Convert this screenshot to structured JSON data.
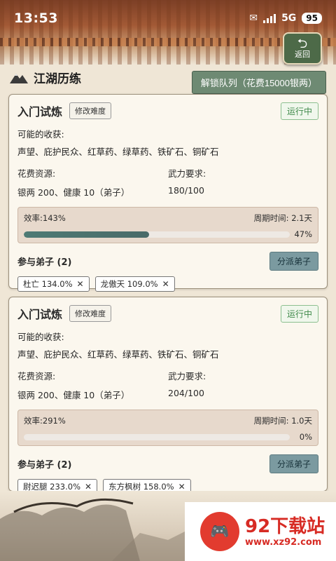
{
  "status_bar": {
    "time": "13:53",
    "network": "5G",
    "battery": "95"
  },
  "nav": {
    "back_label": "返回",
    "back_arrow": "⮌"
  },
  "header": {
    "title": "江湖历练",
    "unlock_label": "解锁队列（花费15000银两）"
  },
  "cards": [
    {
      "title": "入门试炼",
      "modify_label": "修改难度",
      "status": "运行中",
      "rewards_label": "可能的收获:",
      "rewards": "声望、庇护民众、红草药、绿草药、铁矿石、铜矿石",
      "cost_label": "花费资源:",
      "cost_value": "银两 200、健康 10（弟子）",
      "force_label": "武力要求:",
      "force_value": "180/100",
      "efficiency": "效率:143%",
      "cycle": "周期时间: 2.1天",
      "progress": 47,
      "progress_text": "47%",
      "disciples_title": "参与弟子 (2)",
      "assign_label": "分派弟子",
      "disciples": [
        "杜亡 134.0%",
        "龙傲天 109.0%"
      ]
    },
    {
      "title": "入门试炼",
      "modify_label": "修改难度",
      "status": "运行中",
      "rewards_label": "可能的收获:",
      "rewards": "声望、庇护民众、红草药、绿草药、铁矿石、铜矿石",
      "cost_label": "花费资源:",
      "cost_value": "银两 200、健康 10（弟子）",
      "force_label": "武力要求:",
      "force_value": "204/100",
      "efficiency": "效率:291%",
      "cycle": "周期时间: 1.0天",
      "progress": 0,
      "progress_text": "0%",
      "disciples_title": "参与弟子 (2)",
      "assign_label": "分派弟子",
      "disciples": [
        "尉迟腿 233.0%",
        "东方枫树 158.0%"
      ]
    }
  ],
  "watermark": {
    "brand": "92下载站",
    "url": "www.xz92.com"
  },
  "colors": {
    "accent_green": "#6e8a73",
    "running_green": "#3f8a4a",
    "progress_fill": "#4d7a74"
  }
}
